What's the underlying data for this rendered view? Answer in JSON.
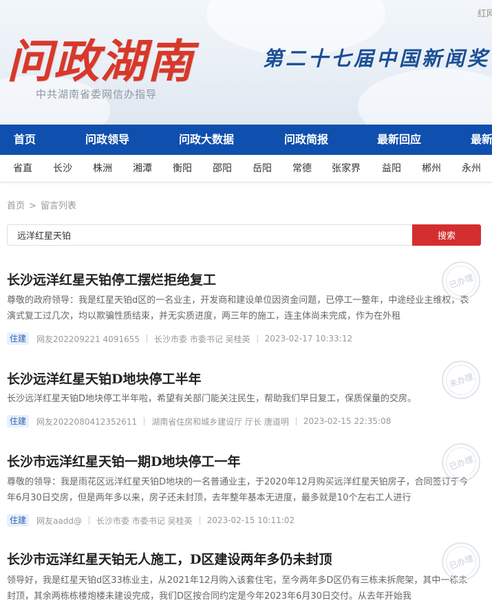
{
  "banner": {
    "top_link": "红网",
    "logo": "问政湖南",
    "subtitle": "中共湖南省委网信办指导",
    "slogan": "第二十七届中国新闻奖一"
  },
  "main_nav": [
    "首页",
    "问政领导",
    "问政大数据",
    "问政简报",
    "最新回应",
    "最新"
  ],
  "region_nav": [
    "省直",
    "长沙",
    "株洲",
    "湘潭",
    "衡阳",
    "邵阳",
    "岳阳",
    "常德",
    "张家界",
    "益阳",
    "郴州",
    "永州"
  ],
  "breadcrumb": {
    "home": "首页",
    "sep": ">",
    "current": "留言列表"
  },
  "search": {
    "value": "远洋红星天铂",
    "button": "搜索"
  },
  "messages": [
    {
      "title": "长沙远洋红星天铂停工摆烂拒绝复工",
      "summary": "尊敬的政府领导：我是红星天铂d区的一名业主，开发商和建设单位因资金问题，已停工一整年，中途经业主维权，表演式复工过几次，均以欺骗性质结束，并无实质进度，两三年的施工，连主体尚未完成，作为在外租",
      "tag": "住建",
      "user": "网友202209221 4091655",
      "dept": "长沙市委 市委书记 吴桂英",
      "time": "2023-02-17 10:33:12",
      "status": "已办理"
    },
    {
      "title": "长沙远洋红星天铂D地块停工半年",
      "summary": "长沙远洋红星天铂D地块停工半年啦，希望有关部门能关注民生，帮助我们早日复工，保质保量的交房。",
      "tag": "住建",
      "user": "网友2022080412352611",
      "dept": "湖南省住房和城乡建设厅 厅长 唐道明",
      "time": "2023-02-15 22:35:08",
      "status": "未办理"
    },
    {
      "title": "长沙市远洋红星天铂一期D地块停工一年",
      "summary": "尊敬的领导：我是雨花区远洋红星天铂D地块的一名普通业主，于2020年12月购买远洋红星天铂房子，合同签订于今年6月30日交房，但是两年多以来，房子还未封顶，去年整年基本无进度，最多就是10个左右工人进行",
      "tag": "住建",
      "user": "网友aadd@",
      "dept": "长沙市委 市委书记 吴桂英",
      "time": "2023-02-15 10:11:02",
      "status": "已办理"
    },
    {
      "title": "长沙市远洋红星天铂无人施工，D区建设两年多仍未封顶",
      "summary": "领导好，我是红星天铂d区33栋业主，从2021年12月购入该套住宅，至今两年多D区仍有三栋未拆爬架，其中一栋未封顶，其余两栋栋楼炮楼未建设完成，我们D区按合同约定是今年2023年6月30日交付。从去年开始我",
      "tag": "住建",
      "user": "",
      "dept": "",
      "time": "",
      "status": "已办理"
    }
  ]
}
